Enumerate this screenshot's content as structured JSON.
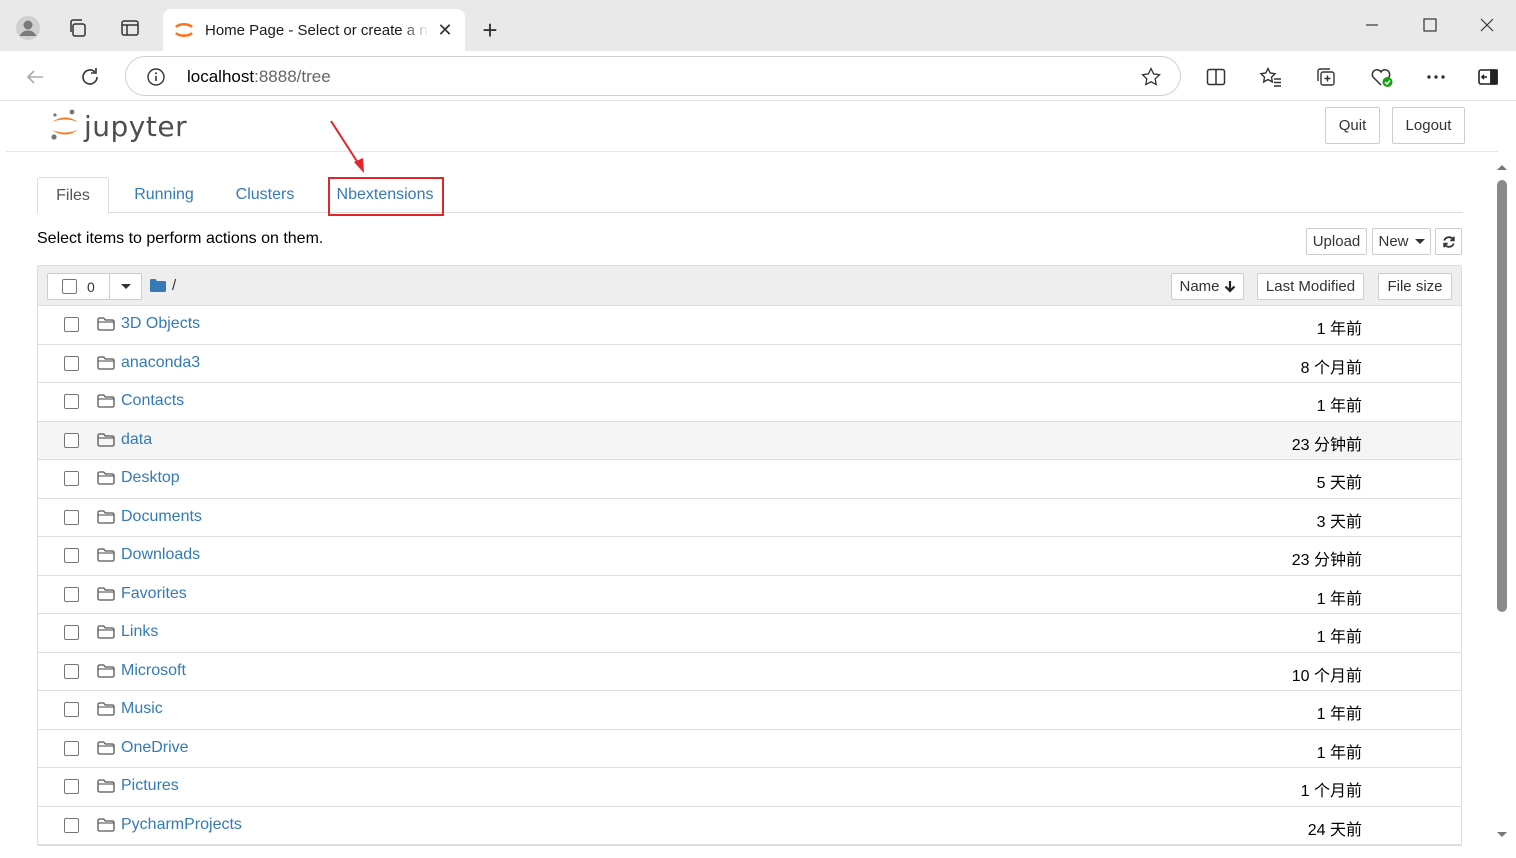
{
  "browser": {
    "tab_title": "Home Page - Select or create a notebook",
    "url_host": "localhost",
    "url_rest": ":8888/tree"
  },
  "jupyter": {
    "logo_text": "jupyter",
    "quit_label": "Quit",
    "logout_label": "Logout",
    "tabs": [
      {
        "label": "Files"
      },
      {
        "label": "Running"
      },
      {
        "label": "Clusters"
      },
      {
        "label": "Nbextensions"
      }
    ],
    "instructions": "Select items to perform actions on them.",
    "upload_label": "Upload",
    "new_label": "New",
    "selected_count": "0",
    "breadcrumb": "/",
    "columns": {
      "name": "Name",
      "last_modified": "Last Modified",
      "file_size": "File size"
    },
    "items": [
      {
        "name": "3D Objects",
        "modified": "1 年前"
      },
      {
        "name": "anaconda3",
        "modified": "8 个月前"
      },
      {
        "name": "Contacts",
        "modified": "1 年前"
      },
      {
        "name": "data",
        "modified": "23 分钟前"
      },
      {
        "name": "Desktop",
        "modified": "5 天前"
      },
      {
        "name": "Documents",
        "modified": "3 天前"
      },
      {
        "name": "Downloads",
        "modified": "23 分钟前"
      },
      {
        "name": "Favorites",
        "modified": "1 年前"
      },
      {
        "name": "Links",
        "modified": "1 年前"
      },
      {
        "name": "Microsoft",
        "modified": "10 个月前"
      },
      {
        "name": "Music",
        "modified": "1 年前"
      },
      {
        "name": "OneDrive",
        "modified": "1 年前"
      },
      {
        "name": "Pictures",
        "modified": "1 个月前"
      },
      {
        "name": "PycharmProjects",
        "modified": "24 天前"
      }
    ]
  },
  "colors": {
    "link": "#337ab7",
    "highlight": "#e3242b",
    "jupyter_orange": "#f37726"
  }
}
